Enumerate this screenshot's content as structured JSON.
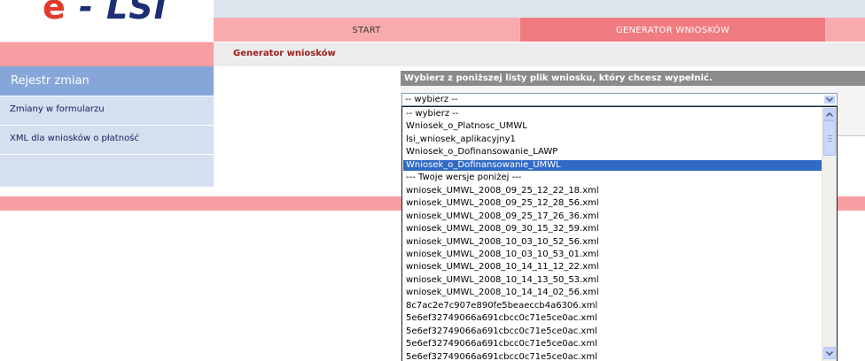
{
  "header": {
    "logo_text": "- LSI",
    "tabs": [
      {
        "label": "START"
      },
      {
        "label": "GENERATOR WNIOSKÓW"
      }
    ]
  },
  "breadcrumb": "Generator wniosków",
  "sidebar": {
    "title": "Rejestr zmian",
    "items": [
      {
        "label": "Zmiany w formularzu"
      },
      {
        "label": "XML dla wniosków o płatność"
      }
    ]
  },
  "main": {
    "prompt": "Wybierz z poniższej listy plik wniosku, który chcesz wypełnić.",
    "select": {
      "value": "-- wybierz --",
      "selected_index": 4,
      "options": [
        "-- wybierz --",
        "Wniosek_o_Platnosc_UMWL",
        "lsi_wniosek_aplikacyjny1",
        "Wniosek_o_Dofinansowanie_LAWP",
        "Wniosek_o_Dofinansowanie_UMWL",
        "--- Twoje wersje poniżej ---",
        "wniosek_UMWL_2008_09_25_12_22_18.xml",
        "wniosek_UMWL_2008_09_25_12_28_56.xml",
        "wniosek_UMWL_2008_09_25_17_26_36.xml",
        "wniosek_UMWL_2008_09_30_15_32_59.xml",
        "wniosek_UMWL_2008_10_03_10_52_56.xml",
        "wniosek_UMWL_2008_10_03_10_53_01.xml",
        "wniosek_UMWL_2008_10_14_11_12_22.xml",
        "wniosek_UMWL_2008_10_14_13_50_53.xml",
        "wniosek_UMWL_2008_10_14_14_02_56.xml",
        "8c7ac2e7c907e890fe5beaeccb4a6306.xml",
        "5e6ef32749066a691cbcc0c71e5ce0ac.xml",
        "5e6ef32749066a691cbcc0c71e5ce0ac.xml",
        "5e6ef32749066a691cbcc0c71e5ce0ac.xml",
        "5e6ef32749066a691cbcc0c71e5ce0ac.xml"
      ]
    }
  },
  "colors": {
    "highlight": "#316ac5",
    "nav_active": "#f07b80",
    "sidebar_title": "#86a6da"
  }
}
